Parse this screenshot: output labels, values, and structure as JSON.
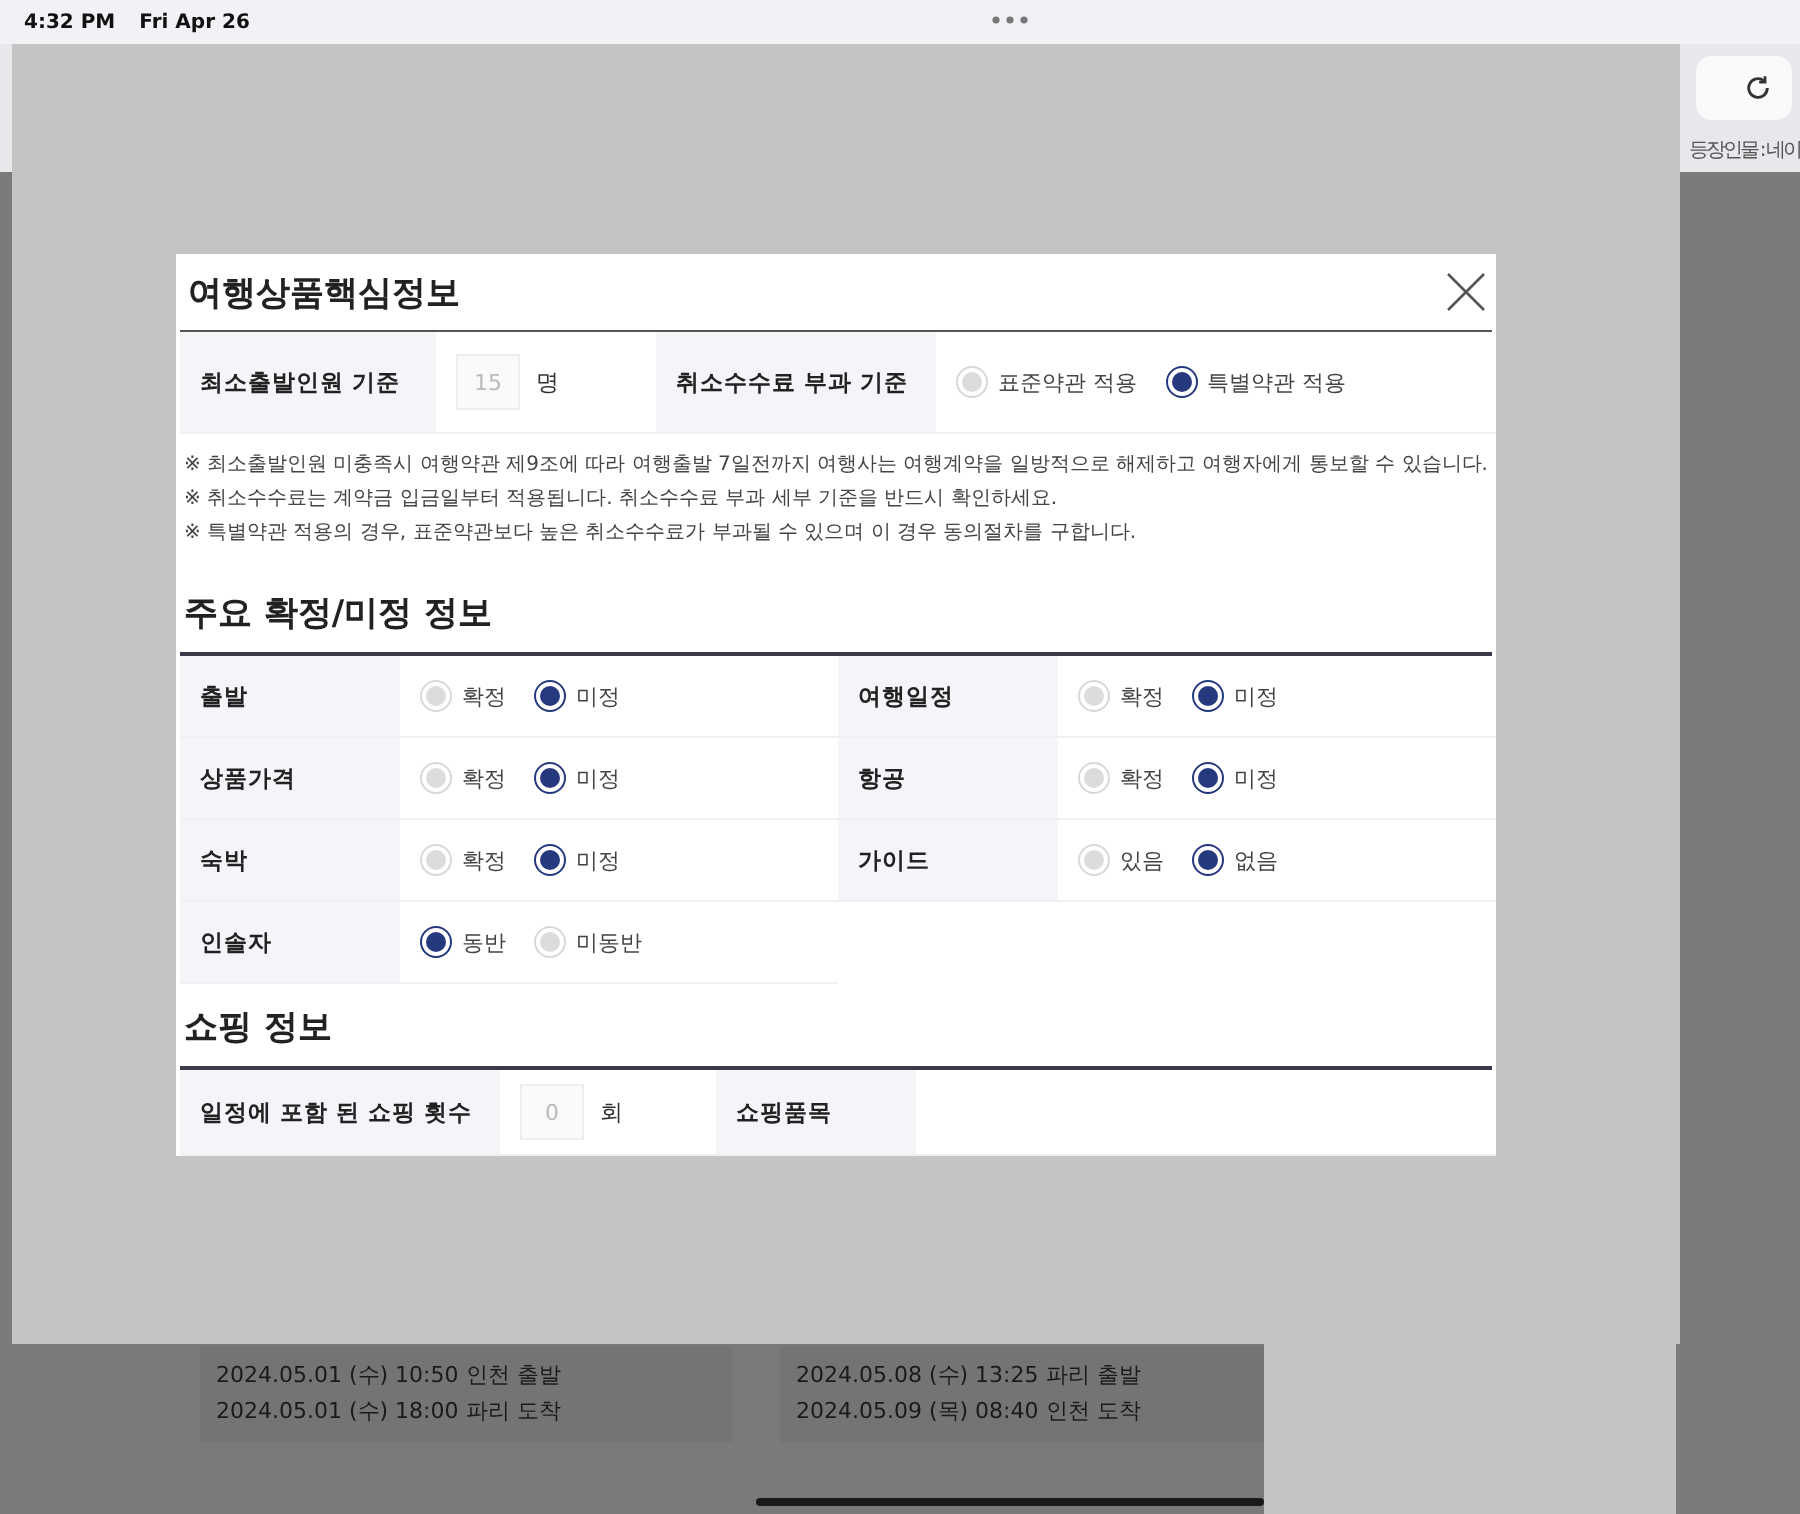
{
  "status_bar": {
    "time": "4:32 PM",
    "date": "Fri Apr 26"
  },
  "browser": {
    "side_text": "등장인물 : 네이"
  },
  "modal": {
    "title": "여행상품핵심정보",
    "min_departure": {
      "label": "최소출발인원 기준",
      "value": "15",
      "unit": "명"
    },
    "cancel_fee": {
      "label": "취소수수료 부과 기준",
      "options": [
        {
          "label": "표준약관 적용",
          "selected": false
        },
        {
          "label": "특별약관 적용",
          "selected": true
        }
      ]
    },
    "notes": [
      "※ 최소출발인원 미충족시 여행약관 제9조에 따라 여행출발 7일전까지 여행사는 여행계약을 일방적으로 해제하고 여행자에게 통보할 수 있습니다.",
      "※ 취소수수료는 계약금 입금일부터 적용됩니다. 취소수수료 부과 세부 기준을 반드시 확인하세요.",
      "※ 특별약관 적용의 경우, 표준약관보다 높은 취소수수료가 부과될 수 있으며 이 경우 동의절차를 구합니다."
    ],
    "status_section": {
      "title": "주요 확정/미정 정보",
      "items": [
        {
          "label": "출발",
          "options": [
            {
              "label": "확정",
              "selected": false
            },
            {
              "label": "미정",
              "selected": true
            }
          ]
        },
        {
          "label": "여행일정",
          "options": [
            {
              "label": "확정",
              "selected": false
            },
            {
              "label": "미정",
              "selected": true
            }
          ]
        },
        {
          "label": "상품가격",
          "options": [
            {
              "label": "확정",
              "selected": false
            },
            {
              "label": "미정",
              "selected": true
            }
          ]
        },
        {
          "label": "항공",
          "options": [
            {
              "label": "확정",
              "selected": false
            },
            {
              "label": "미정",
              "selected": true
            }
          ]
        },
        {
          "label": "숙박",
          "options": [
            {
              "label": "확정",
              "selected": false
            },
            {
              "label": "미정",
              "selected": true
            }
          ]
        },
        {
          "label": "가이드",
          "options": [
            {
              "label": "있음",
              "selected": false
            },
            {
              "label": "없음",
              "selected": true
            }
          ]
        },
        {
          "label": "인솔자",
          "options": [
            {
              "label": "동반",
              "selected": true
            },
            {
              "label": "미동반",
              "selected": false
            }
          ]
        }
      ]
    },
    "shopping_section": {
      "title": "쇼핑 정보",
      "count": {
        "label": "일정에 포함 된 쇼핑 횟수",
        "value": "0",
        "unit": "회"
      },
      "items_label": "쇼핑품목"
    }
  },
  "flights": [
    {
      "lines": [
        "2024.05.01 (수) 10:50 인천 출발",
        "2024.05.01 (수) 18:00 파리 도착"
      ]
    },
    {
      "lines": [
        "2024.05.08 (수) 13:25 파리 출발",
        "2024.05.09 (목) 08:40 인천 도착"
      ]
    }
  ]
}
